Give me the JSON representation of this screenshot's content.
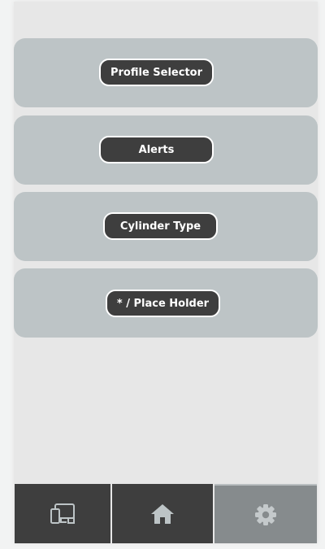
{
  "menu": {
    "items": [
      {
        "label": "Profile Selector"
      },
      {
        "label": "Alerts"
      },
      {
        "label": "Cylinder Type"
      },
      {
        "label": "* / Place Holder"
      }
    ]
  },
  "nav": {
    "items": [
      {
        "icon": "devices-icon",
        "state": "inactive"
      },
      {
        "icon": "home-icon",
        "state": "inactive"
      },
      {
        "icon": "gear-icon",
        "state": "active"
      }
    ]
  },
  "colors": {
    "card": "#bdc4c6",
    "button": "#3e3e3e",
    "nav": "#3e3e3e",
    "nav_active": "#868b8d",
    "background": "#e7e7e7"
  }
}
